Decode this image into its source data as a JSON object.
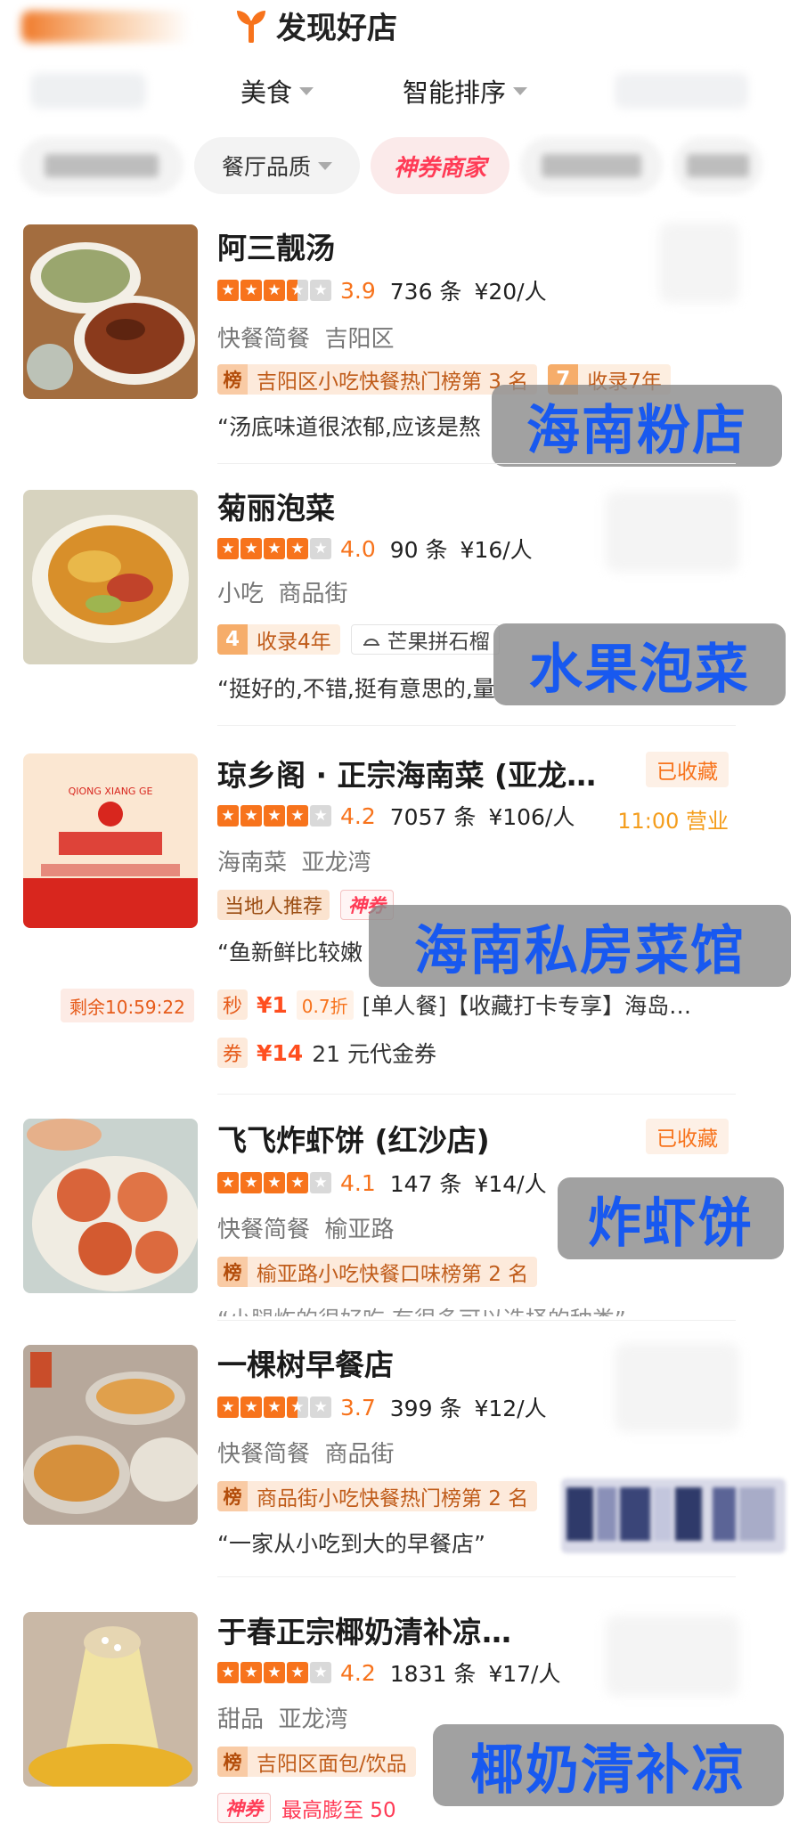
{
  "header": {
    "title": "发现好店"
  },
  "filters": {
    "cuisine": "美食",
    "sort": "智能排序"
  },
  "chips": {
    "quality": "餐厅品质",
    "voucher": "神券商家"
  },
  "restaurants": [
    {
      "name": "阿三靓汤",
      "score": "3.9",
      "reviews": "736 条",
      "price": "¥20/人",
      "category": "快餐简餐",
      "area": "吉阳区",
      "rank_icon": "榜",
      "rank_text": "吉阳区小吃快餐热门榜第 3 名",
      "year_num": "7",
      "year_text": "收录7年",
      "quote": "“汤底味道很浓郁,应该是熬",
      "overlay": "海南粉店"
    },
    {
      "name": "菊丽泡菜",
      "score": "4.0",
      "reviews": "90 条",
      "price": "¥16/人",
      "category": "小吃",
      "area": "商品街",
      "year_num": "4",
      "year_text": "收录4年",
      "tag_text": "芒果拼石榴",
      "quote": "“挺好的,不错,挺有意思的,量",
      "overlay": "水果泡菜"
    },
    {
      "name": "琼乡阁 · 正宗海南菜 (亚龙…",
      "saved": "已收藏",
      "score": "4.2",
      "reviews": "7057 条",
      "price": "¥106/人",
      "hours": "11:00 营业",
      "category": "海南菜",
      "area": "亚龙湾",
      "local_tag": "当地人推荐",
      "voucher_tag": "神券",
      "quote": "“鱼新鲜比较嫩",
      "overlay": "海南私房菜馆",
      "timer": "剩余10:59:22",
      "deal1": {
        "badge": "秒",
        "price": "¥1",
        "discount": "0.7折",
        "text": "[单人餐]【收藏打卡专享】海岛…"
      },
      "deal2": {
        "badge": "券",
        "price": "¥14",
        "text": "21 元代金券"
      }
    },
    {
      "name": "飞飞炸虾饼 (红沙店)",
      "saved": "已收藏",
      "score": "4.1",
      "reviews": "147 条",
      "price": "¥14/人",
      "category": "快餐简餐",
      "area": "榆亚路",
      "rank_icon": "榜",
      "rank_text": "榆亚路小吃快餐口味榜第 2 名",
      "quote": "“小腿炸的很好吃,有很多可以选择的种类”",
      "overlay": "炸虾饼"
    },
    {
      "name": "一棵树早餐店",
      "score": "3.7",
      "reviews": "399 条",
      "price": "¥12/人",
      "category": "快餐简餐",
      "area": "商品街",
      "rank_icon": "榜",
      "rank_text": "商品街小吃快餐热门榜第 2 名",
      "quote": "“一家从小吃到大的早餐店”"
    },
    {
      "name": "于春正宗椰奶清补凉…",
      "score": "4.2",
      "reviews": "1831 条",
      "price": "¥17/人",
      "category": "甜品",
      "area": "亚龙湾",
      "rank_icon": "榜",
      "rank_text": "吉阳区面包/饮品",
      "voucher_tag": "神券",
      "bottom_text": "最高膨至 50",
      "overlay": "椰奶清补凉"
    }
  ],
  "colors": {
    "accent": "#f7731c",
    "overlay_text": "#1859f0",
    "voucher_red": "#ff3b56"
  }
}
